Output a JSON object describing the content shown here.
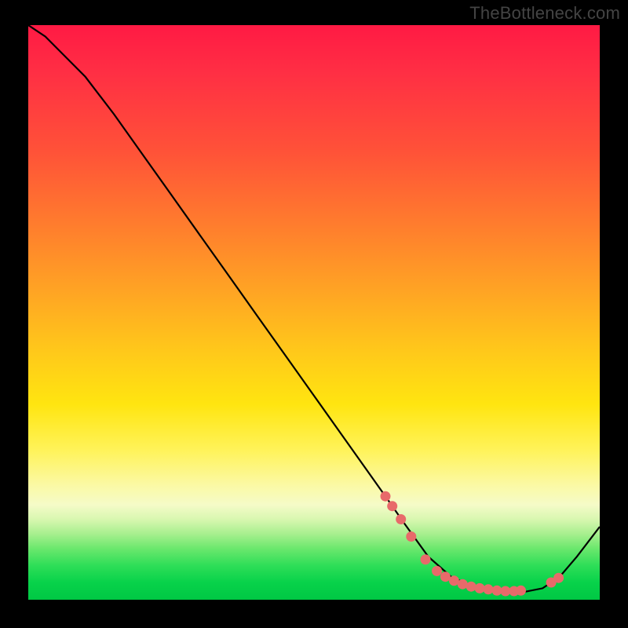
{
  "watermark": "TheBottleneck.com",
  "chart_data": {
    "type": "line",
    "title": "",
    "xlabel": "",
    "ylabel": "",
    "xlim": [
      0,
      100
    ],
    "ylim": [
      0,
      100
    ],
    "series": [
      {
        "name": "curve",
        "x": [
          0,
          3,
          6,
          10,
          15,
          20,
          25,
          30,
          35,
          40,
          45,
          50,
          55,
          60,
          63,
          66,
          70,
          74,
          78,
          82,
          86,
          90,
          93,
          96,
          100
        ],
        "y": [
          100,
          98,
          95,
          91,
          84.5,
          77.5,
          70.5,
          63.5,
          56.5,
          49.5,
          42.5,
          35.5,
          28.5,
          21.5,
          17.3,
          13.0,
          7.5,
          4.0,
          2.2,
          1.3,
          1.2,
          2.0,
          4.0,
          7.5,
          12.7
        ]
      }
    ],
    "highlight_points": {
      "name": "dots",
      "x": [
        62.5,
        63.7,
        65.2,
        67.0,
        69.5,
        71.5,
        73.0,
        74.5,
        76.0,
        77.5,
        79.0,
        80.5,
        82.0,
        83.5,
        85.0,
        86.2,
        91.5,
        92.8
      ],
      "y": [
        18.0,
        16.3,
        14.0,
        11.0,
        7.0,
        5.0,
        4.0,
        3.3,
        2.7,
        2.3,
        2.0,
        1.8,
        1.6,
        1.5,
        1.5,
        1.6,
        3.0,
        3.8
      ]
    },
    "gradient_stops": [
      {
        "pct": 0,
        "color": "#ff1a44"
      },
      {
        "pct": 22,
        "color": "#ff5238"
      },
      {
        "pct": 46,
        "color": "#ffa324"
      },
      {
        "pct": 66,
        "color": "#ffe510"
      },
      {
        "pct": 83,
        "color": "#f5fbc8"
      },
      {
        "pct": 91,
        "color": "#6de86e"
      },
      {
        "pct": 100,
        "color": "#00c844"
      }
    ]
  }
}
